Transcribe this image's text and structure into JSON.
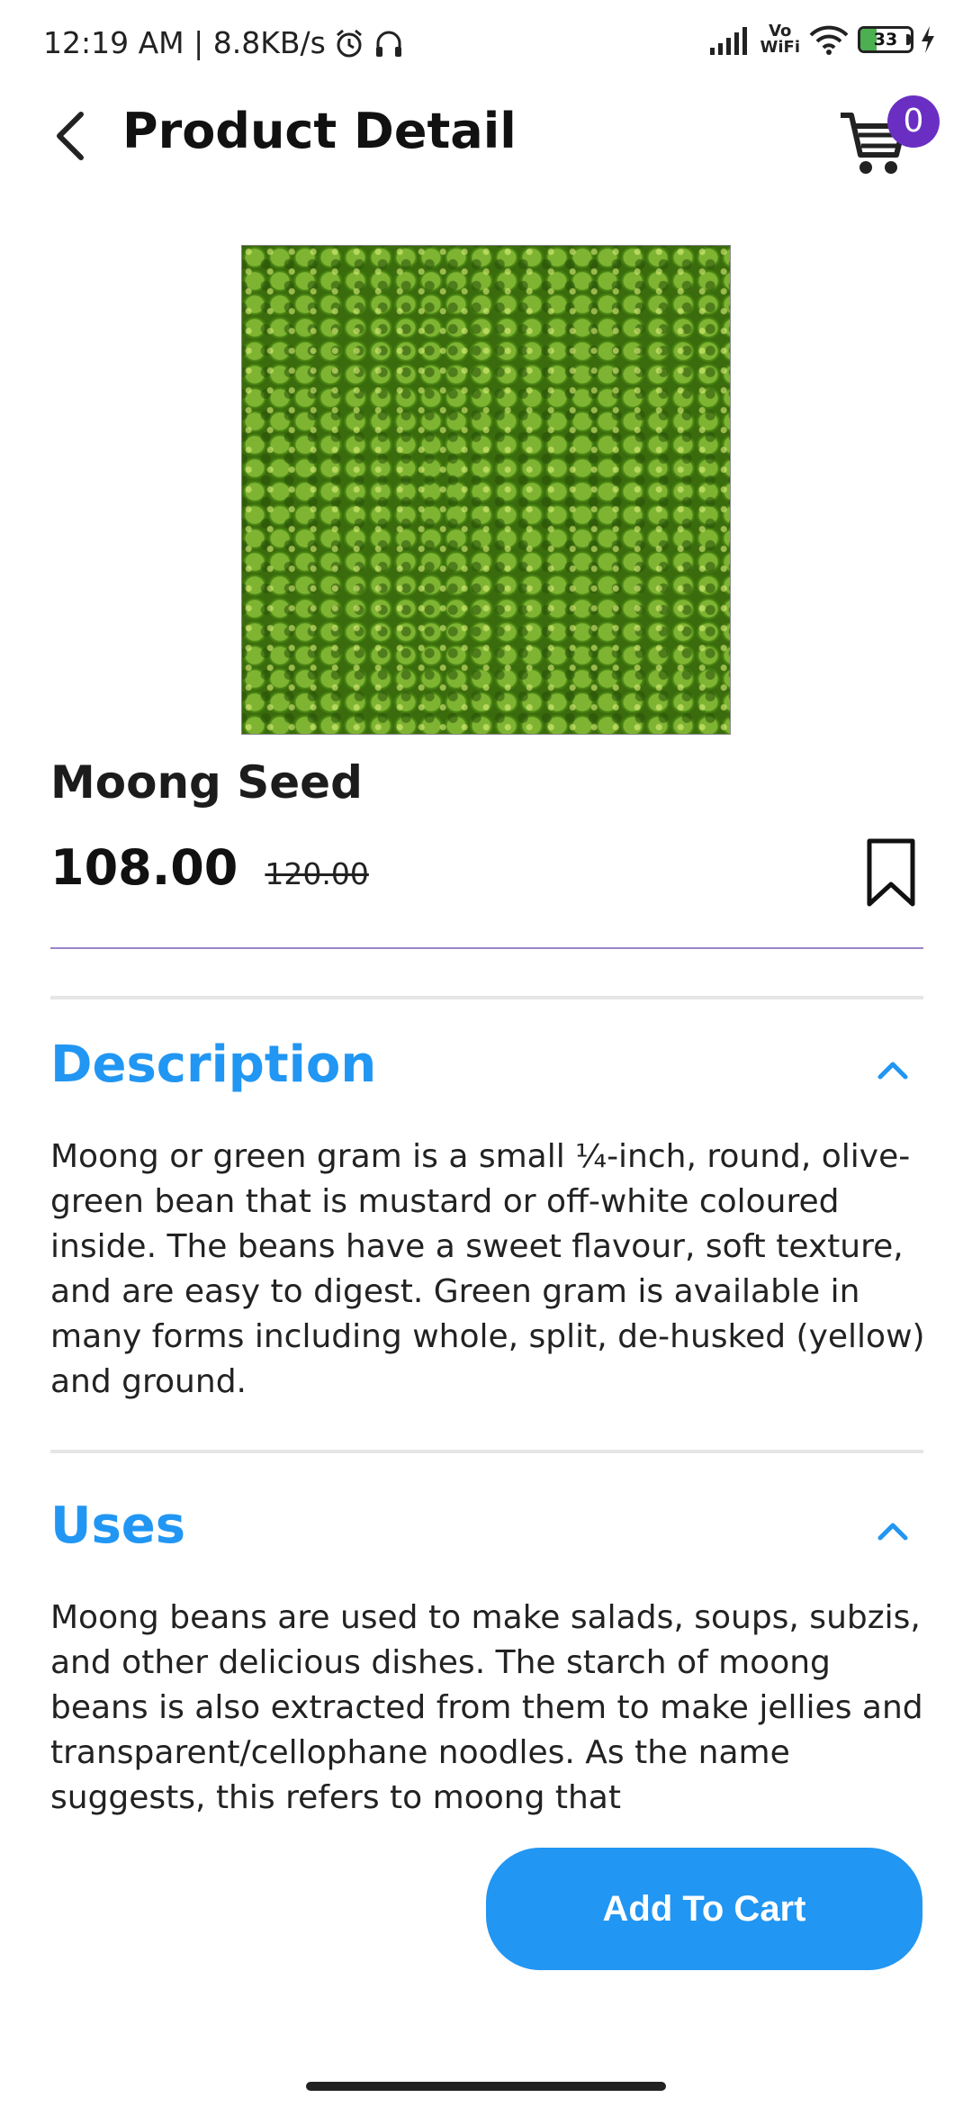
{
  "status_bar": {
    "time": "12:19 AM | 8.8KB/s",
    "vowifi_top": "Vo",
    "vowifi_bottom": "WiFi",
    "battery_level": "33",
    "battery_fraction": 0.33
  },
  "header": {
    "title": "Product Detail",
    "cart_count": "0"
  },
  "product": {
    "name": "Moong Seed",
    "price": "108.00",
    "old_price": "120.00"
  },
  "sections": {
    "description": {
      "title": "Description",
      "body": "Moong or green gram is a small ¼-inch, round, olive-green bean that is mustard or off-white coloured inside. The beans have a sweet flavour, soft texture, and are easy to digest. Green gram is available in many forms including whole, split, de-husked (yellow) and ground."
    },
    "uses": {
      "title": "Uses",
      "body": "Moong beans are used to make salads, soups, subzis, and other delicious dishes. The starch of moong beans is also extracted from them to make jellies and transparent/cellophane noodles. As the name suggests, this refers to moong that"
    }
  },
  "actions": {
    "add_to_cart": "Add To  Cart"
  },
  "colors": {
    "accent": "#2196f3",
    "badge": "#6a2fc2",
    "divider": "#9a85c9"
  }
}
